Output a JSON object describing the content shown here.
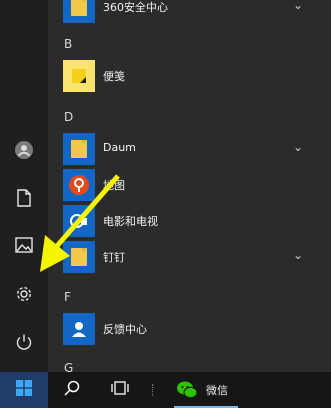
{
  "colors": {
    "accent": "#1466c4",
    "annotation": "#f5f500",
    "taskbar": "#161616"
  },
  "start_menu": {
    "sections": [
      {
        "letter": "B"
      },
      {
        "letter": "D"
      },
      {
        "letter": "F"
      },
      {
        "letter": "G"
      }
    ],
    "apps": [
      {
        "name": "360安全中心",
        "icon": "folder-icon",
        "expandable": true
      },
      {
        "name": "便笺",
        "icon": "sticky-notes-icon",
        "expandable": false
      },
      {
        "name": "Daum",
        "icon": "folder-icon",
        "expandable": true
      },
      {
        "name": "地图",
        "icon": "maps-icon",
        "expandable": false
      },
      {
        "name": "电影和电视",
        "icon": "movies-tv-icon",
        "expandable": false
      },
      {
        "name": "钉钉",
        "icon": "folder-icon",
        "expandable": true
      },
      {
        "name": "反馈中心",
        "icon": "feedback-hub-icon",
        "expandable": false
      }
    ],
    "left_rail": [
      "user-icon",
      "documents-icon",
      "pictures-icon",
      "settings-icon",
      "power-icon"
    ]
  },
  "taskbar": {
    "items": [
      "windows-start-icon",
      "search-icon",
      "task-view-icon",
      "wechat-icon"
    ],
    "wechat_label": "微信"
  }
}
